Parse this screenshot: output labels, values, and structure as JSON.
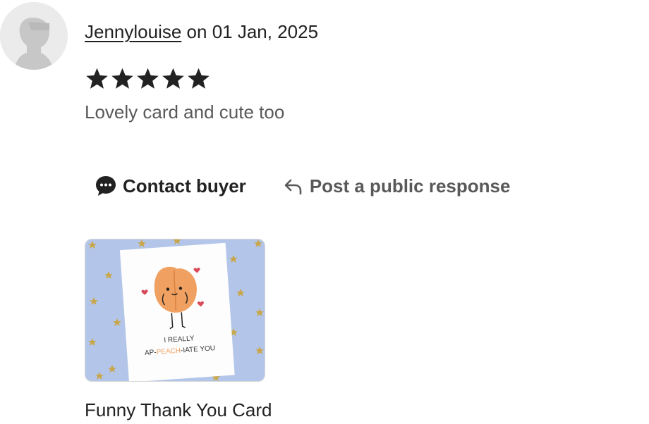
{
  "review": {
    "reviewer_name": "Jennylouise",
    "date_text": "on 01 Jan, 2025",
    "rating": 5,
    "rating_max": 5,
    "text": "Lovely card and cute too"
  },
  "actions": {
    "contact_label": "Contact buyer",
    "contact_icon": "chat-bubble-icon",
    "respond_label": "Post a public response",
    "respond_icon": "reply-arrow-icon"
  },
  "product": {
    "title": "Funny Thank You Card",
    "card_line1": "I REALLY",
    "card_line2_a": "AP-",
    "card_line2_b": "PEACH",
    "card_line2_c": "-IATE YOU"
  },
  "colors": {
    "text": "#222222",
    "muted": "#595959",
    "thumb_background": "#b3c6ea",
    "star_gold": "#c8a64a",
    "peach": "#f0a060"
  }
}
